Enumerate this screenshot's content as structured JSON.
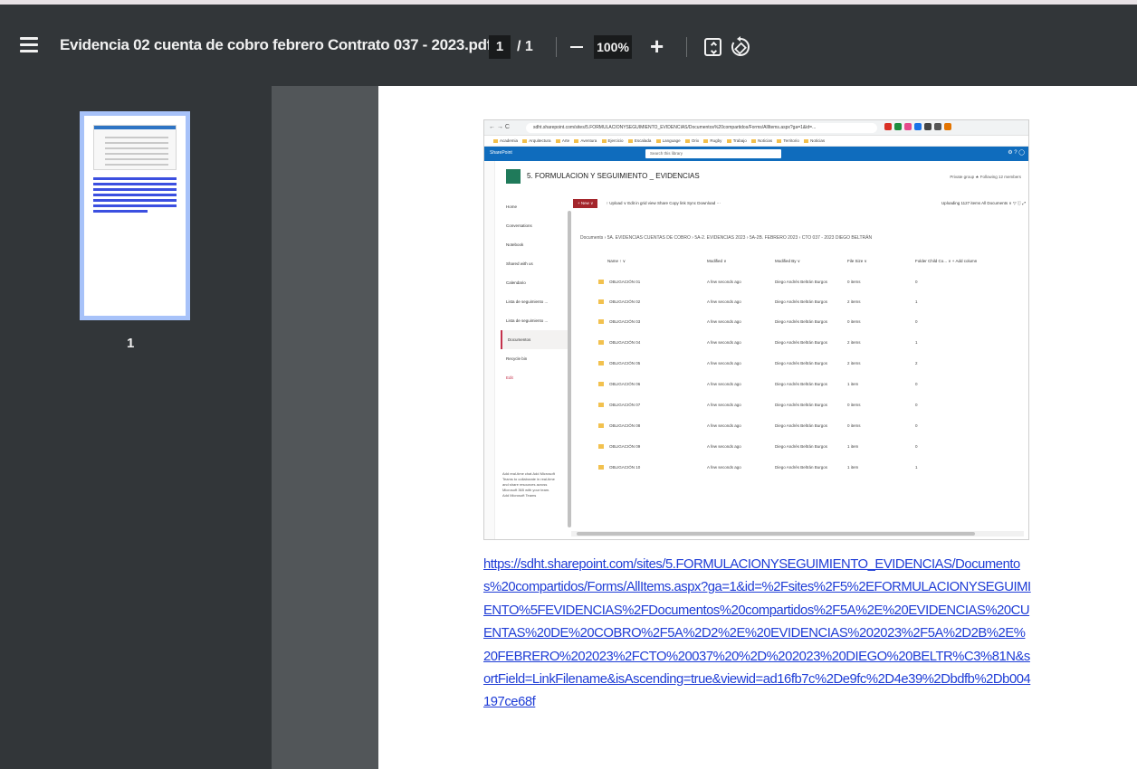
{
  "toolbar": {
    "title": "Evidencia 02 cuenta de cobro febrero Contrato 037 - 2023.pdf",
    "current_page": "1",
    "page_separator": "/ 1",
    "zoom": "100%",
    "zoom_in_label": "+"
  },
  "sidebar": {
    "thumbnail_number": "1"
  },
  "embedded": {
    "url": "sdht.sharepoint.com/sites/5.FORMULACIONYSEGUIMIENTO_EVIDENCIAS/Documentos%20compartidos/Forms/AllItems.aspx?ga=1&id=...",
    "bookmarks": [
      "Academia",
      "Arquitectura",
      "Arte",
      "Aventura",
      "Ejercicio",
      "Escalada",
      "Language",
      "Orix",
      "Rugby",
      "Trabajo",
      "Noticias",
      "Territorio",
      "Noticias"
    ],
    "suite_name": "SharePoint",
    "search_placeholder": "Search this library",
    "site_logo": "FY",
    "site_title": "5. FORMULACION Y SEGUIMIENTO _ EVIDENCIAS",
    "site_right": "Private group  ★ Following  12 members",
    "nav_items": [
      "Home",
      "Conversations",
      "Notebook",
      "Shared with us",
      "Calendario",
      "Lista de seguimiento ...",
      "Lista de seguimiento ...",
      "Documentos",
      "Recycle bin",
      "Edit"
    ],
    "commands": {
      "new": "+ New ∨",
      "rest": "↑ Upload ∨    Edit in grid view    Share    Copy link    Sync    Download    ···",
      "right": "Uploading 1127 items   All Documents ∨   ▽   ⓘ   ⤢"
    },
    "breadcrumb": "Documents  ›  5A. EVIDENCIAS CUENTAS DE COBRO  ›  5A-2. EVIDENCIAS 2023  ›  5A-2B. FEBRERO 2023  ›  CTO 037 - 2023 DIEGO BELTRÁN",
    "columns": [
      "Name ↑ ∨",
      "Modified ∨",
      "Modified By ∨",
      "File Size ∨",
      "Folder Child Co... ∨   + Add column"
    ],
    "rows": [
      {
        "name": "OBLIGACIÓN 01",
        "modified": "A few seconds ago",
        "by": "Diego Andrés Beltrán Burgos",
        "size": "0 items",
        "count": "0"
      },
      {
        "name": "OBLIGACIÓN 02",
        "modified": "A few seconds ago",
        "by": "Diego Andrés Beltrán Burgos",
        "size": "2 items",
        "count": "1"
      },
      {
        "name": "OBLIGACIÓN 03",
        "modified": "A few seconds ago",
        "by": "Diego Andrés Beltrán Burgos",
        "size": "0 items",
        "count": "0"
      },
      {
        "name": "OBLIGACIÓN 04",
        "modified": "A few seconds ago",
        "by": "Diego Andrés Beltrán Burgos",
        "size": "2 items",
        "count": "1"
      },
      {
        "name": "OBLIGACIÓN 05",
        "modified": "A few seconds ago",
        "by": "Diego Andrés Beltrán Burgos",
        "size": "2 items",
        "count": "2"
      },
      {
        "name": "OBLIGACIÓN 06",
        "modified": "A few seconds ago",
        "by": "Diego Andrés Beltrán Burgos",
        "size": "1 item",
        "count": "0"
      },
      {
        "name": "OBLIGACIÓN 07",
        "modified": "A few seconds ago",
        "by": "Diego Andrés Beltrán Burgos",
        "size": "0 items",
        "count": "0"
      },
      {
        "name": "OBLIGACIÓN 08",
        "modified": "A few seconds ago",
        "by": "Diego Andrés Beltrán Burgos",
        "size": "0 items",
        "count": "0"
      },
      {
        "name": "OBLIGACIÓN 09",
        "modified": "A few seconds ago",
        "by": "Diego Andrés Beltrán Burgos",
        "size": "1 item",
        "count": "0"
      },
      {
        "name": "OBLIGACIÓN 10",
        "modified": "A few seconds ago",
        "by": "Diego Andrés Beltrán Burgos",
        "size": "1 item",
        "count": "1"
      }
    ],
    "chat_panel": "Add real-time chat  Add Microsoft Teams to collaborate in real-time and share resources across Microsoft 365 with your team.  Add Microsoft Teams"
  },
  "link": "https://sdht.sharepoint.com/sites/5.FORMULACIONYSEGUIMIENTO_EVIDENCIAS/Documentos%20compartidos/Forms/AllItems.aspx?ga=1&id=%2Fsites%2F5%2EFORMULACIONYSEGUIMIENTO%5FEVIDENCIAS%2FDocumentos%20compartidos%2F5A%2E%20EVIDENCIAS%20CUENTAS%20DE%20COBRO%2F5A%2D2%2E%20EVIDENCIAS%202023%2F5A%2D2B%2E%20FEBRERO%202023%2FCTO%20037%20%2D%202023%20DIEGO%20BELTR%C3%81N&sortField=LinkFilename&isAscending=true&viewid=ad16fb7c%2De9fc%2D4e39%2Dbdfb%2Db004197ce68f",
  "colors": {
    "toolbar_bg": "#323639",
    "viewer_bg": "#525659",
    "link": "#1f3dd6",
    "thumb_highlight": "#a7c2f9",
    "sharepoint_blue": "#0f6cbd"
  }
}
